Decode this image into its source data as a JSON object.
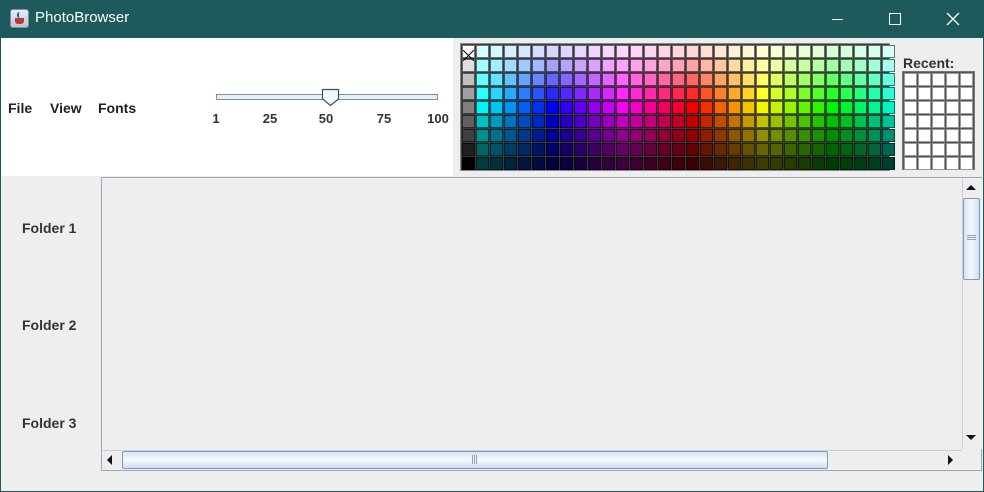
{
  "window": {
    "title": "PhotoBrowser"
  },
  "menu": {
    "items": [
      "File",
      "View",
      "Fonts"
    ]
  },
  "slider": {
    "value": 50,
    "min": 1,
    "max": 100,
    "labels": [
      "1",
      "25",
      "50",
      "75",
      "100"
    ]
  },
  "colors": {
    "titlebar": "#1e5a5c",
    "background": "#eeeeee"
  },
  "swatches": {
    "recent_label": "Recent:",
    "selected": "none"
  },
  "folders": [
    "Folder 1",
    "Folder 2",
    "Folder 3"
  ]
}
